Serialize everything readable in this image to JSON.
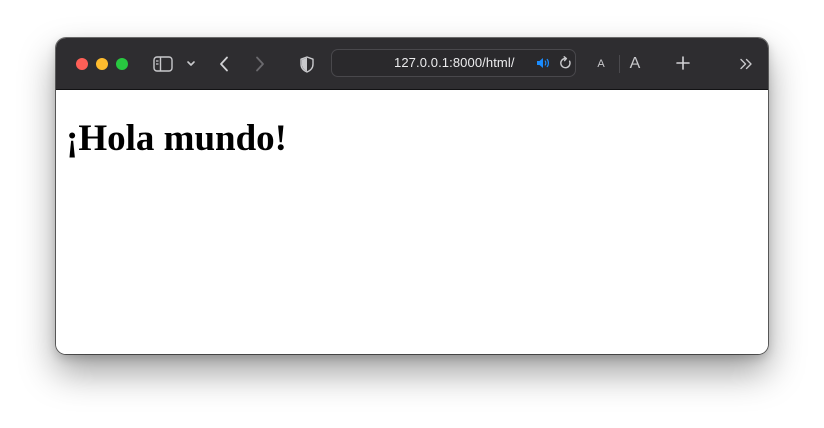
{
  "browser": {
    "address_bar": {
      "url": "127.0.0.1:8000/html/"
    },
    "icons": {
      "sidebar": "sidebar-icon",
      "chevron": "chevron-down-icon",
      "back": "back-icon",
      "forward": "forward-icon",
      "shield": "privacy-shield-icon",
      "audio": "speaker-icon",
      "reload": "reload-icon",
      "text_smaller": "text-smaller-icon",
      "text_larger": "text-larger-icon",
      "new_tab": "plus-icon",
      "overflow": "double-chevron-icon"
    },
    "text_size": {
      "small": "A",
      "large": "A"
    },
    "colors": {
      "toolbar": "#2e2d30",
      "close": "#fe5f57",
      "minimize": "#febc2e",
      "zoom": "#28c840",
      "audio_accent": "#1a8cff"
    }
  },
  "page": {
    "heading": "¡Hola mundo!"
  }
}
